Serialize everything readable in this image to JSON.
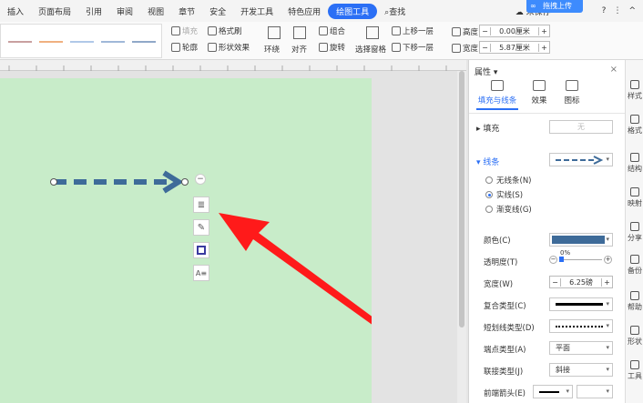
{
  "menubar": {
    "items": [
      "插入",
      "页面布局",
      "引用",
      "审阅",
      "视图",
      "章节",
      "安全",
      "开发工具",
      "特色应用",
      "绘图工具",
      "查找"
    ],
    "active_index": 9,
    "unsaved": "未保存",
    "upload": "拖拽上传",
    "help": "?",
    "more": "⋮",
    "collapse": "^"
  },
  "toolbar": {
    "fill": "填充",
    "format_painter": "格式刷",
    "outline": "轮廓",
    "shape_effect": "形状效果",
    "wrap": "环绕",
    "align": "对齐",
    "group": "组合",
    "rotate": "旋转",
    "select_pane": "选择窗格",
    "bring_forward": "上移一层",
    "send_backward": "下移一层",
    "height_label": "高度:",
    "height_value": "0.00厘米",
    "width_label": "宽度:",
    "width_value": "5.87厘米",
    "gallery_colors": [
      "#c9a0a0",
      "#f0b080",
      "#b0c8e8",
      "#a0b8d8",
      "#90a8c8",
      "#f2b2a2"
    ]
  },
  "panel": {
    "title": "属性",
    "tabs": [
      "填充与线条",
      "效果",
      "图标"
    ],
    "fill_section": "填充",
    "fill_value": "无",
    "line_section": "线条",
    "radios": [
      "无线条(N)",
      "实线(S)",
      "渐变线(G)"
    ],
    "radio_selected": 1,
    "color_label": "颜色(C)",
    "line_color": "#3e6b99",
    "transparency_label": "透明度(T)",
    "transparency_value": "0%",
    "width_label": "宽度(W)",
    "width_value": "6.25磅",
    "compound_label": "复合类型(C)",
    "dash_label": "短划线类型(D)",
    "cap_label": "端点类型(A)",
    "cap_value": "平面",
    "join_label": "联接类型(J)",
    "join_value": "斜接",
    "arrow_label": "前端箭头(E)"
  },
  "rail": [
    "样式",
    "格式",
    "结构",
    "映射",
    "分享",
    "备份",
    "帮助",
    "形状",
    "工具"
  ],
  "canvas": {
    "shape_color": "#3e6b99",
    "annotation_color": "#ff1a1a",
    "page_color": "#c8ecc9"
  }
}
